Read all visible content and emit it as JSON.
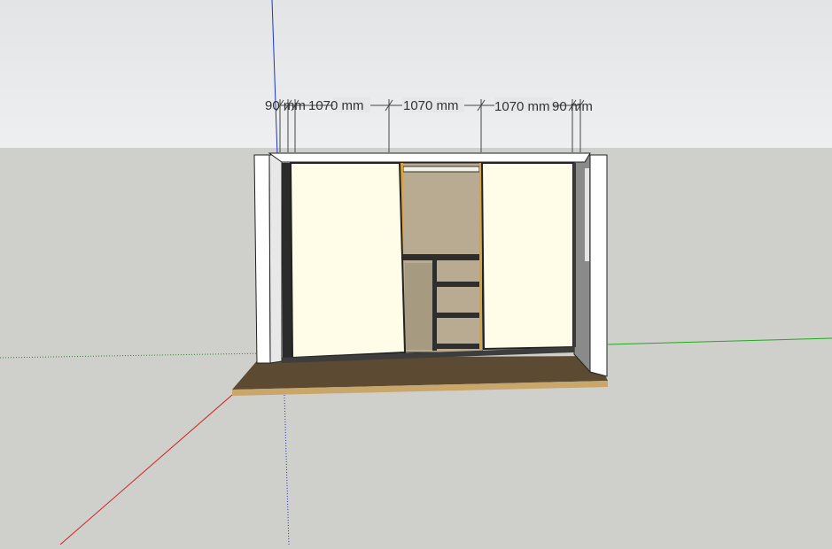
{
  "scene": {
    "dimensions": [
      {
        "label": "90 mm"
      },
      {
        "label": "1070 mm"
      },
      {
        "label": "1070 mm"
      },
      {
        "label": "1070 mm"
      },
      {
        "label": "90 mm"
      }
    ]
  },
  "colors": {
    "sky_top": "#e8e9ea",
    "sky_bottom": "#dfe0e2",
    "ground": "#cfcfcb",
    "floor_board": "#5c4a33",
    "door_panel": "#fffde8",
    "frame_white": "#ffffff",
    "interior_wall": "#b9ab91",
    "inner_edge_orange": "#d9a23a",
    "shelf_dark": "#2e2e2e",
    "axis_red": "#cc2222",
    "axis_green": "#22aa22",
    "axis_blue": "#2233cc"
  }
}
